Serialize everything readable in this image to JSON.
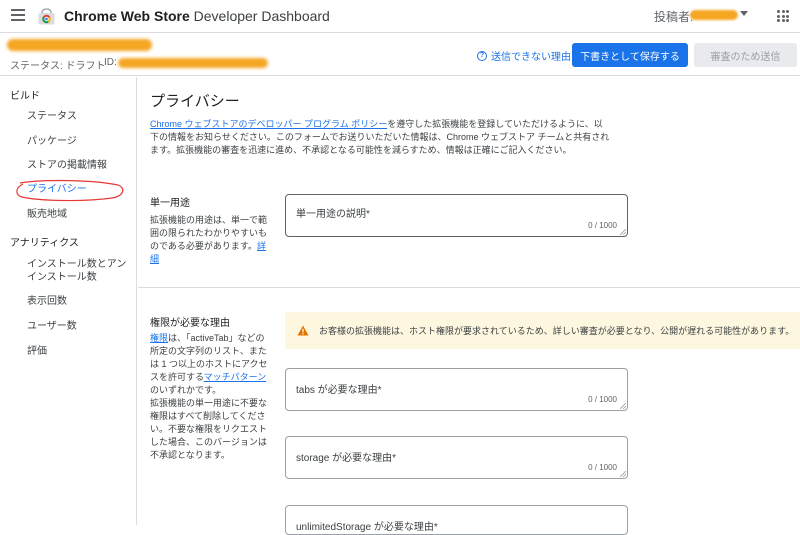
{
  "topbar": {
    "app_title_bold": "Chrome Web Store",
    "app_title_rest": " Developer Dashboard",
    "publisher_label": "投稿者:"
  },
  "header": {
    "status": "ステータス: ドラフト",
    "id_label": "ID:",
    "why_link": "送信できない理由",
    "save_button": "下書きとして保存する",
    "submit_button": "審査のため送信"
  },
  "sidebar": {
    "build_label": "ビルド",
    "build_items": [
      "ステータス",
      "パッケージ",
      "ストアの掲載情報",
      "プライバシー",
      "販売地域"
    ],
    "analytics_label": "アナリティクス",
    "analytics_items": [
      "インストール数とアンインストール数",
      "表示回数",
      "ユーザー数",
      "評価"
    ],
    "active": "プライバシー"
  },
  "main": {
    "title": "プライバシー",
    "intro_link": "Chrome ウェブストアのデベロッパー プログラム ポリシー",
    "intro_text": "を遵守した拡張機能を登録していただけるように、以下の情報をお知らせください。このフォームでお送りいただいた情報は、Chrome ウェブストア チームと共有されます。拡張機能の審査を迅速に進め、不承認となる可能性を減らすため、情報は正確にご記入ください。",
    "single_purpose": {
      "label": "単一用途",
      "desc": "拡張機能の用途は、単一で範囲の限られたわかりやすいものである必要があります。",
      "desc_link": "詳細",
      "field_label": "単一用途の説明*",
      "count": "0 / 1000"
    },
    "permissions": {
      "label": "権限が必要な理由",
      "desc_link1": "権限",
      "desc_part1": "は、「activeTab」などの所定の文字列のリスト、または 1 つ以上のホストにアクセスを許可する",
      "desc_link2": "マッチパターン",
      "desc_part2": "のいずれかです。",
      "desc_part3": "拡張機能の単一用途に不要な権限はすべて削除してください。不要な権限をリクエストした場合、このバージョンは不承認となります。",
      "warning": "お客様の拡張機能は、ホスト権限が要求されているため、詳しい審査が必要となり、公開が遅れる可能性があります。",
      "fields": [
        {
          "label": "tabs が必要な理由*",
          "count": "0 / 1000"
        },
        {
          "label": "storage が必要な理由*",
          "count": "0 / 1000"
        },
        {
          "label": "unlimitedStorage が必要な理由*"
        }
      ]
    }
  },
  "colors": {
    "accent": "#1a73e8",
    "warning_bg": "#fef7e0",
    "warning_icon": "#e37400",
    "annotation": "#e53935",
    "redaction": "#f5a623"
  }
}
